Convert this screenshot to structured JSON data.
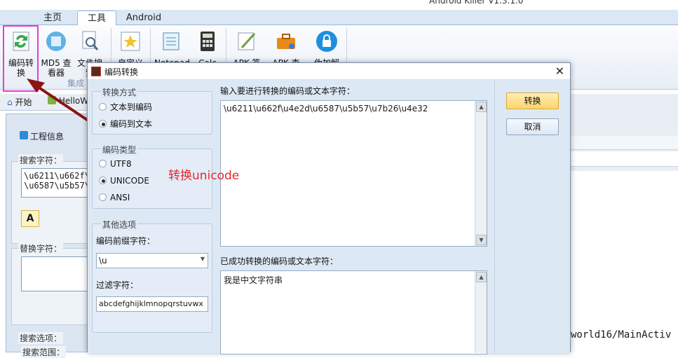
{
  "app": {
    "title": "Android Killer V1.3.1.0"
  },
  "tabs": [
    {
      "label": "主页"
    },
    {
      "label": "工具"
    },
    {
      "label": "Android"
    }
  ],
  "ribbon": {
    "buttons": [
      {
        "label": "编码转换",
        "icon": "convert-icon"
      },
      {
        "label": "MD5 查看器",
        "icon": "md5-icon"
      },
      {
        "label": "文件搜索",
        "icon": "file-search-icon"
      },
      {
        "label": "自定义",
        "icon": "star-icon"
      },
      {
        "label": "Notepad",
        "icon": "notepad-icon"
      },
      {
        "label": "Calc",
        "icon": "calculator-icon"
      },
      {
        "label": "APK 签",
        "icon": "sign-icon"
      },
      {
        "label": "APK 查",
        "icon": "toolbox-icon"
      },
      {
        "label": "伪加解",
        "icon": "lock-icon"
      }
    ],
    "group_label": "集成"
  },
  "doc_tabs": [
    {
      "label": "开始"
    },
    {
      "label": "HelloW"
    }
  ],
  "left_panel": {
    "subtab": "工程信息",
    "search_legend": "搜索字符：",
    "search_text_line1": "\\u6211\\u662f\\u",
    "search_text_line2": "\\u6587\\u5b57\\u",
    "replace_legend": "替换字符：",
    "options_legend": "搜索选项：",
    "scope_label": "搜索范围："
  },
  "background": {
    "path_text": "world16/MainActiv"
  },
  "dialog": {
    "title": "编码转换",
    "mode_group": {
      "label": "转换方式",
      "options": [
        "文本到编码",
        "编码到文本"
      ],
      "selected": 1
    },
    "type_group": {
      "label": "编码类型",
      "options": [
        "UTF8",
        "UNICODE",
        "ANSI"
      ],
      "selected": 1
    },
    "other_group": {
      "label": "其他选项",
      "prefix_label": "编码前缀字符：",
      "prefix_value": "\\u",
      "filter_label": "过滤字符：",
      "filter_value": "abcdefghijklmnopqrstuvwx"
    },
    "input_label": "输入要进行转换的编码或文本字符：",
    "input_value": "\\u6211\\u662f\\u4e2d\\u6587\\u5b57\\u7b26\\u4e32",
    "output_label": "已成功转换的编码或文本字符：",
    "output_value": "我是中文字符串",
    "convert_button": "转换",
    "cancel_button": "取消"
  },
  "annotation": {
    "text": "转换unicode",
    "color": "#e3282c"
  }
}
